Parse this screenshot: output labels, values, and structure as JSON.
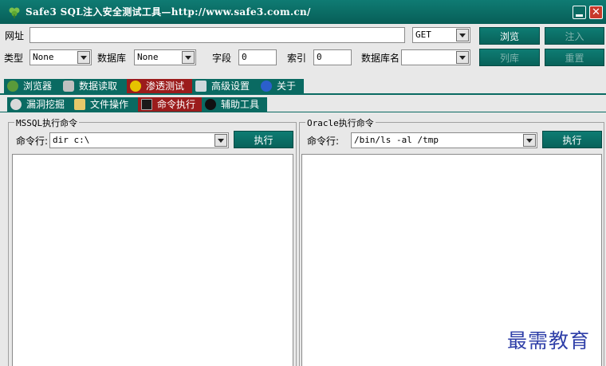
{
  "window": {
    "title": "Safe3 SQL注入安全测试工具—http://www.safe3.com.cn/",
    "close_glyph": "✕"
  },
  "form": {
    "url_label": "网址",
    "url_value": "",
    "method_value": "GET",
    "browse_label": "浏览",
    "inject_label": "注入",
    "type_label": "类型",
    "type_value": "None",
    "db_label": "数据库",
    "db_value": "None",
    "field_label": "字段",
    "field_value": "0",
    "index_label": "索引",
    "index_value": "0",
    "dbname_label": "数据库名",
    "dbname_value": "",
    "list_db_label": "列库",
    "reset_label": "重置"
  },
  "main_tabs": [
    {
      "label": "浏览器"
    },
    {
      "label": "数据读取"
    },
    {
      "label": "渗透测试"
    },
    {
      "label": "高级设置"
    },
    {
      "label": "关于"
    }
  ],
  "sub_tabs": [
    {
      "label": "漏洞挖掘"
    },
    {
      "label": "文件操作"
    },
    {
      "label": "命令执行"
    },
    {
      "label": "辅助工具"
    }
  ],
  "mssql": {
    "title": "MSSQL执行命令",
    "cmd_label": "命令行:",
    "cmd_value": "dir c:\\",
    "exec_label": "执行",
    "output": ""
  },
  "oracle": {
    "title": "Oracle执行命令",
    "cmd_label": "命令行:",
    "cmd_value": "/bin/ls -al /tmp",
    "exec_label": "执行",
    "output": ""
  },
  "watermark": "最需教育",
  "colors": {
    "titlebar": "#0a6a62",
    "active_tab": "#9b1c1c",
    "button": "#0a6e66",
    "watermark": "#2f3fa8"
  }
}
